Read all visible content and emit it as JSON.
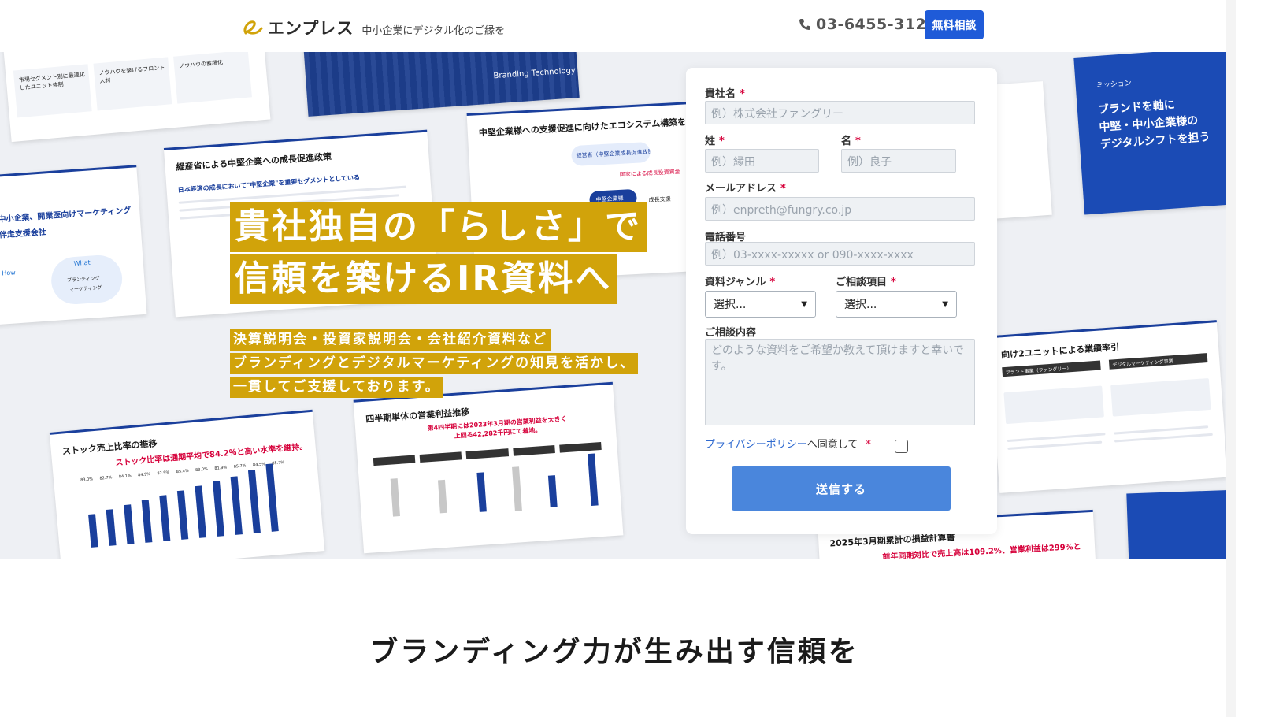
{
  "header": {
    "logo_name": "エンプレス",
    "logo_tagline": "中小企業にデジタル化のご縁を",
    "phone": "03-6455-3124",
    "cta_label": "無料相談",
    "accent_color": "#1f5bd8"
  },
  "hero": {
    "headline_line1": "貴社独自の「らしさ」で",
    "headline_line2": "信頼を築けるIR資料へ",
    "sub_lines": [
      "決算説明会・投資家説明会・会社紹介資料など",
      "ブランディングとデジタルマーケティングの知見を活かし、",
      "一貫してご支援しております。"
    ],
    "highlight_color": "#d1a30a",
    "background_slides": {
      "s1_texts": [
        "市場セグメント別に最適化したユニット体制",
        "ノウハウを繋げるフロント人材",
        "ノウハウの蓄積化"
      ],
      "s2_text": "Branding Technology",
      "s3_title": "経産省による中堅企業への成長促進政策",
      "s3_body": "日本経済の成長において\"中堅企業\"を重要セグメントとしている",
      "s4_title": "中堅企業様への支援促進に向けたエコシステム構築を目指す",
      "s4_nodes": [
        "経営者（中堅企業成長促進政策）",
        "中堅企業様",
        "国家による成長投資資金",
        "成長支援"
      ],
      "s5_title": "中小企業、開業医向けマーケティング伴走支援会社",
      "s5_what": "What",
      "s5_how": "How",
      "s5_items": [
        "ブランディング",
        "マーケティング"
      ],
      "s6_title": "ストック売上比率の推移",
      "s6_sub": "ストック比率は通期平均で84.2％と高い水準を維持。",
      "s6_labels": [
        "83.0%",
        "82.7%",
        "84.1%",
        "84.9%",
        "82.9%",
        "85.4%",
        "83.0%",
        "81.9%",
        "85.7%",
        "84.5%",
        "85.7%"
      ],
      "s7_title": "四半期単体の営業利益推移",
      "s7_sub": "第4四半期には2023年3月期の営業利益を大きく上回る42,282千円にて着地。",
      "s8_title": "向け2ユニットによる業績率引",
      "s8_units": [
        "ブランド事業（ファングリー）",
        "デジタルマーケティング事業"
      ],
      "s9_title": "2025年3月期累計の損益計算書",
      "s9_sub": "前年同期対比で売上高は109.2%、営業利益は299%と",
      "mission_label": "ミッション",
      "mission_line1": "ブランドを軸に",
      "mission_line2": "中堅・中小企業様の",
      "mission_line3": "デジタルシフトを担う"
    }
  },
  "form": {
    "company_label": "貴社名",
    "company_placeholder": "例）株式会社ファングリー",
    "last_name_label": "姓",
    "last_name_placeholder": "例）縁田",
    "first_name_label": "名",
    "first_name_placeholder": "例）良子",
    "email_label": "メールアドレス",
    "email_placeholder": "例）enpreth@fungry.co.jp",
    "phone_label": "電話番号",
    "phone_placeholder": "例）03-xxxx-xxxxx or 090-xxxx-xxxx",
    "genre_label": "資料ジャンル",
    "genre_value": "選択...",
    "topic_label": "ご相談項目",
    "topic_value": "選択...",
    "message_label": "ご相談内容",
    "message_placeholder": "どのような資料をご希望か教えて頂けますと幸いです。",
    "required_mark": "*",
    "privacy_link": "プライバシーポリシー",
    "privacy_text": "へ同意して",
    "submit_label": "送信する"
  },
  "section": {
    "heading": "ブランディング力が生み出す信頼を"
  }
}
